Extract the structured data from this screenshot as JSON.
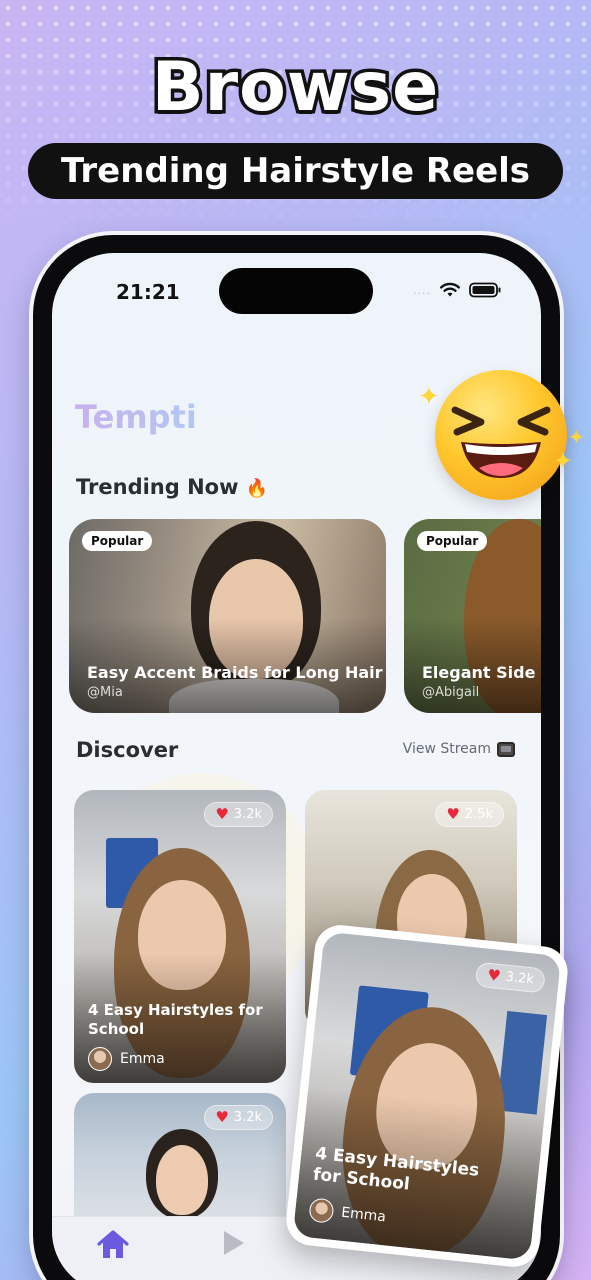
{
  "promo": {
    "headline": "Browse",
    "subheadline": "Trending Hairstyle Reels"
  },
  "status_bar": {
    "time": "21:21",
    "signal": "....",
    "icons": [
      "wifi-icon",
      "battery-icon"
    ]
  },
  "app": {
    "logo": "Tempti"
  },
  "trending": {
    "title": "Trending Now",
    "title_emoji": "🔥",
    "cards": [
      {
        "badge": "Popular",
        "title": "Easy Accent Braids for Long Hair",
        "handle": "@Mia"
      },
      {
        "badge": "Popular",
        "title": "Elegant Side B",
        "handle": "@Abigail"
      }
    ]
  },
  "discover": {
    "title": "Discover",
    "view_stream": "View Stream",
    "cards": [
      {
        "likes": "3.2k",
        "title": "4 Easy Hairstyles for School",
        "author": "Emma"
      },
      {
        "likes": "2.5k",
        "title": "",
        "author": ""
      },
      {
        "likes": "3.2k",
        "title": "",
        "author": ""
      }
    ]
  },
  "floating_card": {
    "likes": "3.2k",
    "title": "4 Easy Hairstyles for School",
    "author": "Emma"
  },
  "tab_bar": {
    "items": [
      "home-icon",
      "play-icon"
    ]
  },
  "colors": {
    "logo": "#c6b4f0",
    "heart": "#e8283b",
    "tab_active": "#6a5ae0"
  }
}
